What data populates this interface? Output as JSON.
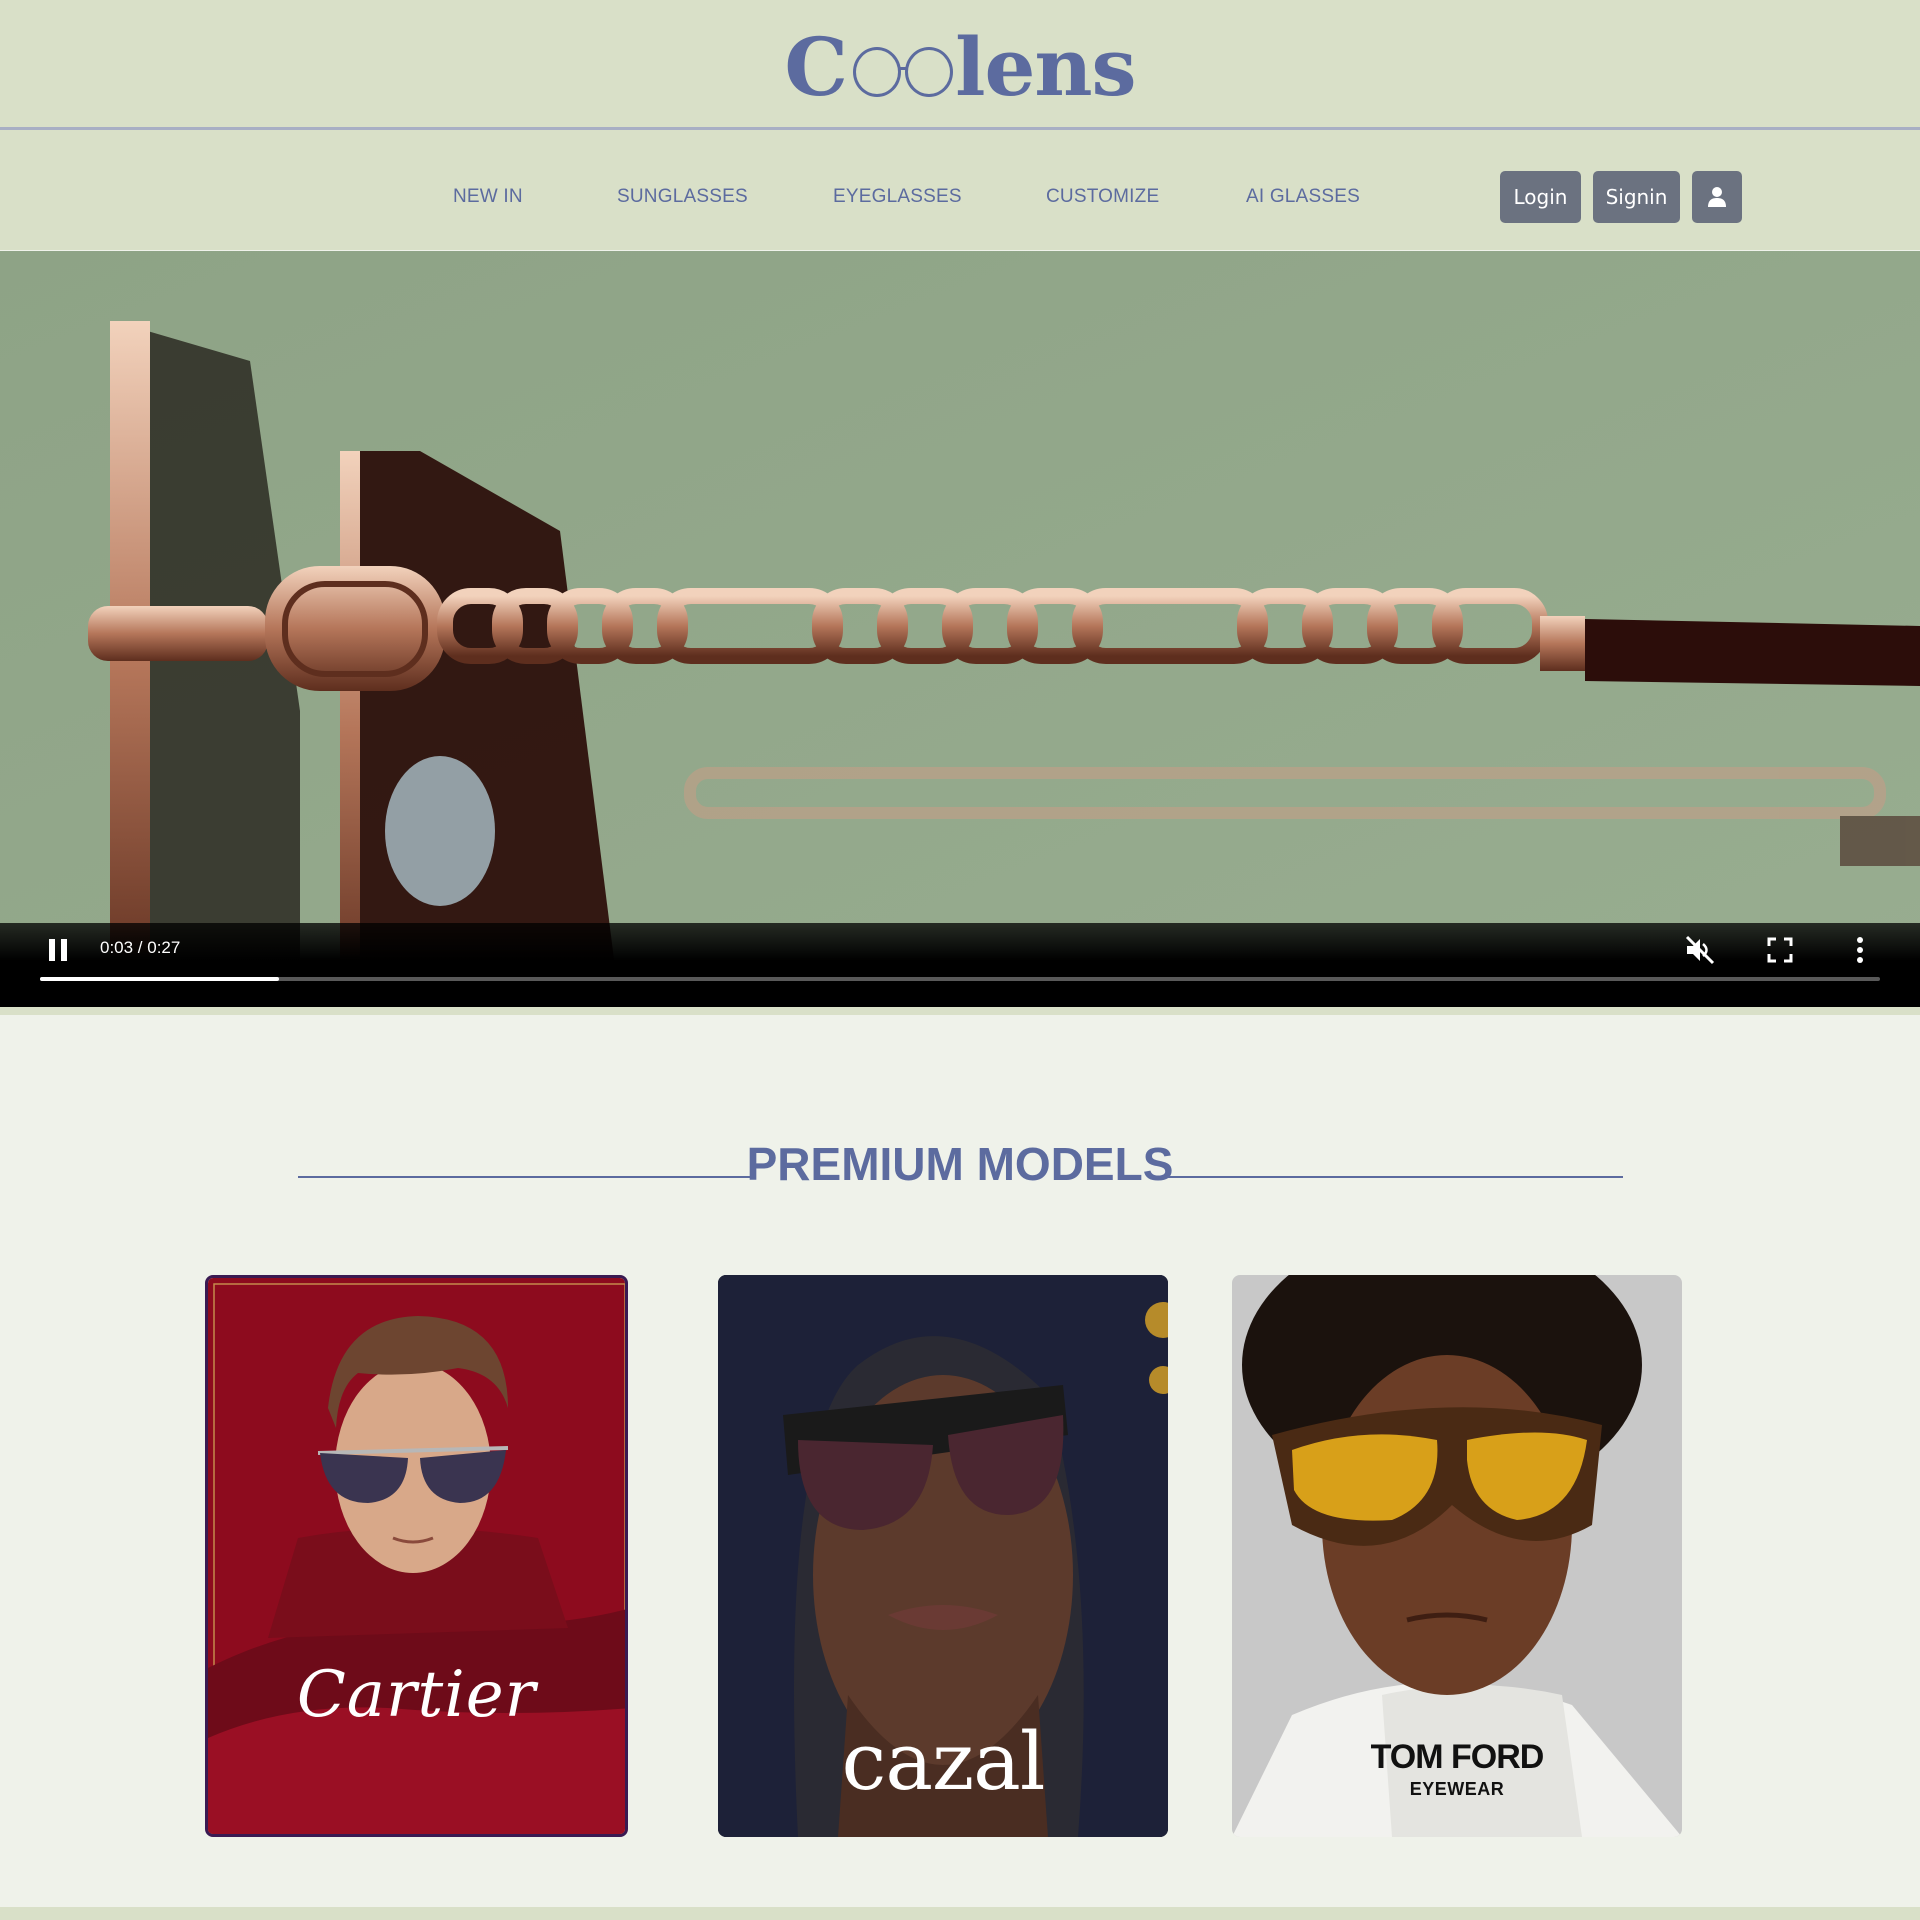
{
  "header": {
    "logo": {
      "prefix": "C",
      "suffix": "lens"
    },
    "nav": [
      {
        "label": "NEW IN"
      },
      {
        "label": "SUNGLASSES"
      },
      {
        "label": "EYEGLASSES"
      },
      {
        "label": "CUSTOMIZE"
      },
      {
        "label": "AI GLASSES"
      }
    ],
    "login_label": "Login",
    "signin_label": "Signin",
    "profile_icon": "user-icon"
  },
  "video": {
    "time_display": "0:03 / 0:27",
    "progress": 0.13,
    "state": "playing",
    "muted": true,
    "icons": [
      "pause-icon",
      "volume-muted-icon",
      "fullscreen-icon",
      "more-options-icon"
    ]
  },
  "premium": {
    "title": "PREMIUM MODELS",
    "cards": [
      {
        "brand": "Cartier",
        "background": "#8d0b1e"
      },
      {
        "brand": "cazal",
        "background": "#2a2a33"
      },
      {
        "brand_line1": "TOM FORD",
        "brand_line2": "EYEWEAR",
        "background": "#c8c8c8"
      }
    ]
  },
  "colors": {
    "header_bg": "#d9e0c8",
    "accent": "#5c6b9f",
    "button_bg": "#6b7280",
    "page_bg": "#eff2ea",
    "video_bg": "#92a88a"
  }
}
